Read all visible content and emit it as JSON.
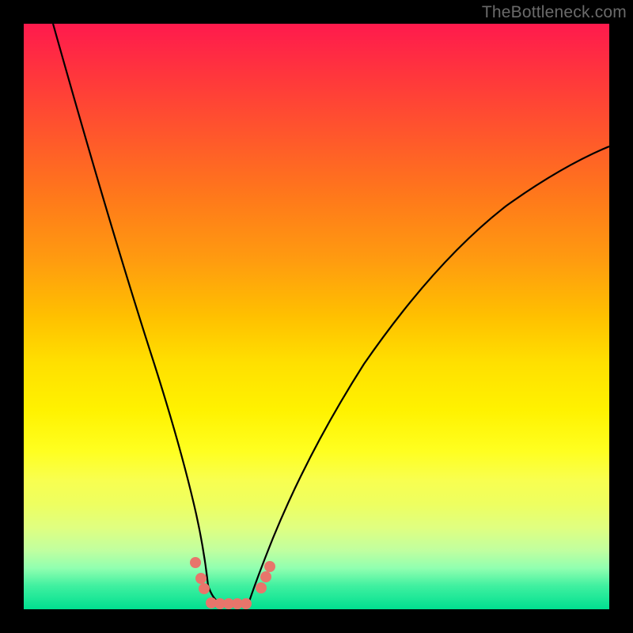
{
  "watermark": "TheBottleneck.com",
  "chart_data": {
    "type": "line",
    "title": "",
    "xlabel": "",
    "ylabel": "",
    "xlim": [
      0,
      100
    ],
    "ylim": [
      0,
      100
    ],
    "grid": false,
    "series": [
      {
        "name": "left-branch",
        "x": [
          5,
          10,
          15,
          20,
          24,
          27,
          29,
          30.5,
          31.5
        ],
        "y": [
          100,
          78,
          56,
          36,
          20,
          10,
          4,
          1.5,
          0.5
        ]
      },
      {
        "name": "right-branch",
        "x": [
          39,
          40,
          42,
          45,
          50,
          57,
          65,
          75,
          85,
          95,
          100
        ],
        "y": [
          0.5,
          1.5,
          4,
          9,
          17,
          28,
          40,
          53,
          64,
          74,
          79
        ]
      },
      {
        "name": "valley-floor",
        "x": [
          31.5,
          33,
          35,
          37,
          39
        ],
        "y": [
          0.5,
          0.2,
          0.1,
          0.2,
          0.5
        ]
      }
    ],
    "marker_points": {
      "comment": "salmon-colored approximate data markers near valley",
      "points": [
        {
          "x": 29.3,
          "y": 8.0
        },
        {
          "x": 30.3,
          "y": 5.2
        },
        {
          "x": 30.8,
          "y": 3.5
        },
        {
          "x": 32.0,
          "y": 1.1
        },
        {
          "x": 33.5,
          "y": 0.9
        },
        {
          "x": 35.0,
          "y": 0.9
        },
        {
          "x": 36.5,
          "y": 0.9
        },
        {
          "x": 38.0,
          "y": 0.9
        },
        {
          "x": 40.5,
          "y": 3.7
        },
        {
          "x": 41.3,
          "y": 5.5
        },
        {
          "x": 42.0,
          "y": 7.3
        }
      ]
    },
    "colors": {
      "curve": "#000000",
      "markers": "#e8756b",
      "background_top": "#ff1a4d",
      "background_bottom": "#00e090"
    }
  }
}
